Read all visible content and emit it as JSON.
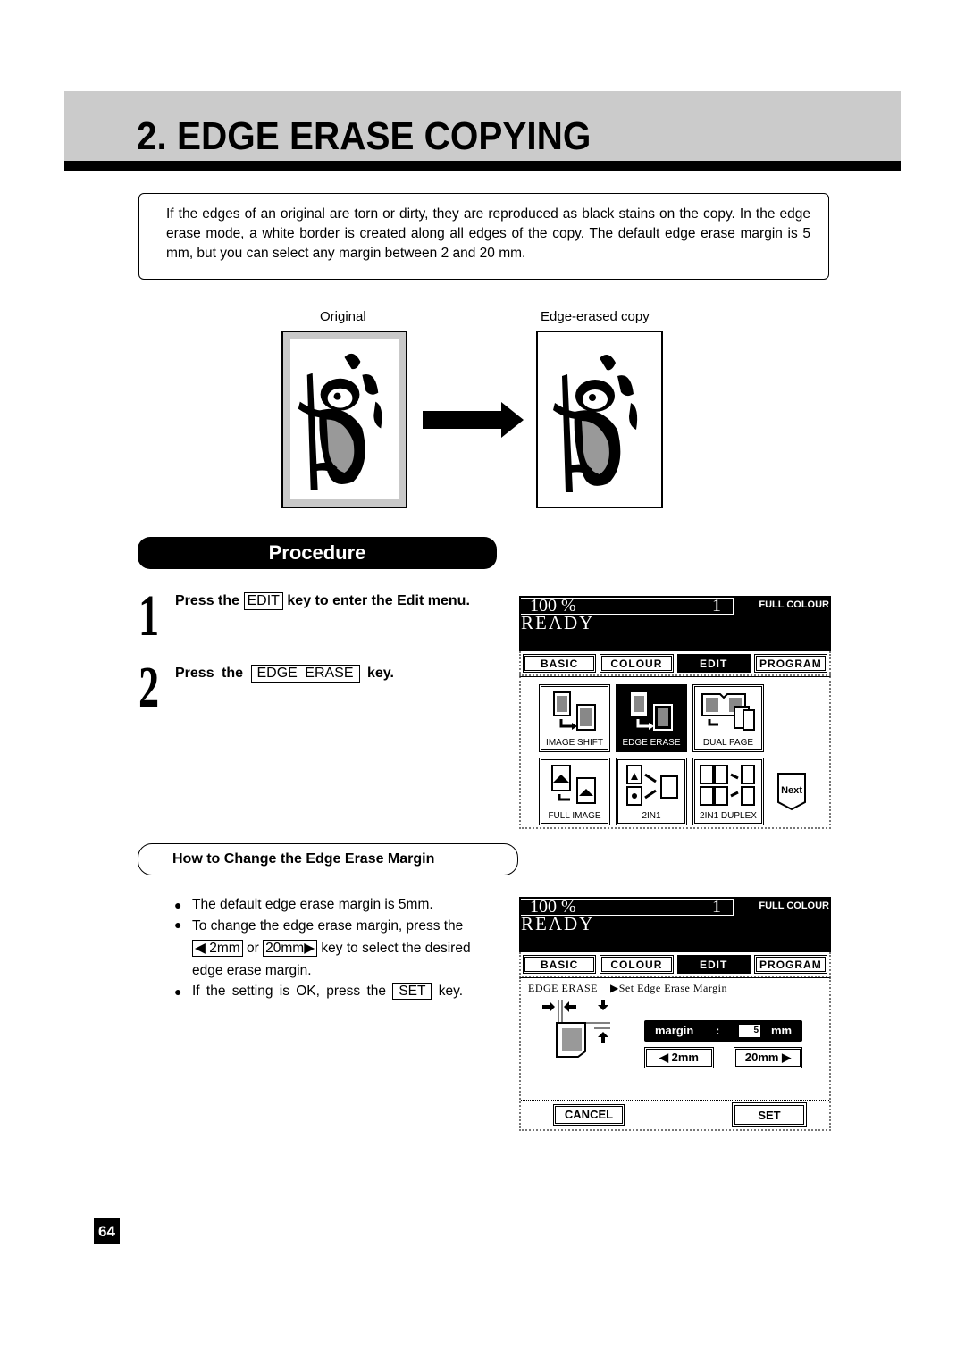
{
  "header": {
    "title": "2. EDGE ERASE COPYING"
  },
  "intro": {
    "text": "If the edges of an original are torn or dirty, they are reproduced as black stains on the copy. In the edge erase mode, a white border is created along all edges of the copy. The default edge erase margin is 5 mm, but you can select any margin between 2 and 20 mm."
  },
  "illustration": {
    "original_caption": "Original",
    "copy_caption": "Edge-erased copy",
    "arrow_icon": "right-arrow-icon"
  },
  "procedure": {
    "title": "Procedure",
    "steps": [
      {
        "number": "1",
        "prefix": "Press the",
        "key": "EDIT",
        "suffix": "key to enter the Edit menu."
      },
      {
        "number": "2",
        "prefix": "Press the",
        "key": "EDGE ERASE",
        "suffix": "key."
      }
    ]
  },
  "margin_section": {
    "title": "How to Change the Edge Erase Margin",
    "bullet1": "The default edge erase margin is 5mm.",
    "bullet2_a": "To change the edge erase margin, press the",
    "bullet2_key1": "2mm",
    "bullet2_or": "or",
    "bullet2_key2": "20mm",
    "bullet2_b": "key to select the desired edge erase margin.",
    "bullet3_a": "If the setting is OK, press the",
    "bullet3_key": "SET",
    "bullet3_b": "key."
  },
  "panel1": {
    "zoom": "100 %",
    "copies": "1",
    "colour_mode": "FULL COLOUR",
    "status": "READY",
    "tabs": [
      "BASIC",
      "COLOUR",
      "EDIT",
      "PROGRAM"
    ],
    "active_tab": "EDIT",
    "functions": [
      "IMAGE SHIFT",
      "EDGE ERASE",
      "DUAL PAGE",
      "FULL IMAGE",
      "2IN1",
      "2IN1 DUPLEX"
    ],
    "active_function": "EDGE ERASE",
    "next_label": "Next"
  },
  "panel2": {
    "zoom": "100 %",
    "copies": "1",
    "colour_mode": "FULL COLOUR",
    "status": "READY",
    "tabs": [
      "BASIC",
      "COLOUR",
      "EDIT",
      "PROGRAM"
    ],
    "active_tab": "EDIT",
    "screen_title": "EDGE ERASE",
    "screen_subtitle": "▶Set Edge Erase Margin",
    "margin_label": "margin",
    "margin_colon": ":",
    "margin_value": "5",
    "margin_unit": "mm",
    "dec_label": "◀  2mm",
    "inc_label": "20mm ▶",
    "cancel_label": "CANCEL",
    "set_label": "SET"
  },
  "page_number": "64"
}
